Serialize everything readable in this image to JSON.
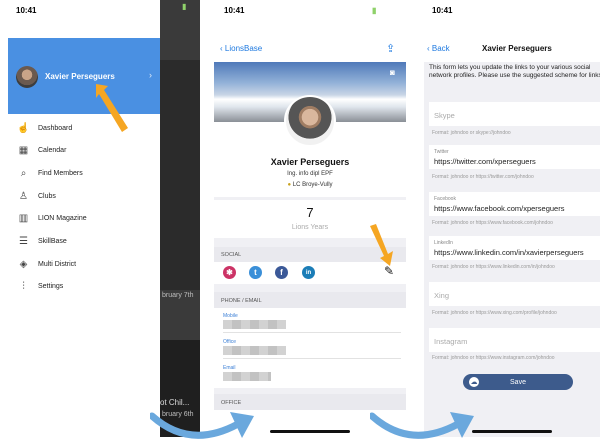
{
  "status_time": "10:41",
  "screen1": {
    "user_name": "Xavier Perseguers",
    "menu": [
      {
        "label": "Dashboard",
        "icon": "hand-pointer-icon"
      },
      {
        "label": "Calendar",
        "icon": "calendar-icon"
      },
      {
        "label": "Find Members",
        "icon": "magnifier-icon"
      },
      {
        "label": "Clubs",
        "icon": "medal-icon"
      },
      {
        "label": "LION Magazine",
        "icon": "magazine-icon"
      },
      {
        "label": "SkillBase",
        "icon": "list-icon"
      },
      {
        "label": "Multi District",
        "icon": "layers-icon"
      },
      {
        "label": "Settings",
        "icon": "sliders-icon"
      }
    ],
    "background_texts": [
      "bruary 7th",
      "ot Chil...",
      "bruary 6th"
    ]
  },
  "screen2": {
    "back_label": "LionsBase",
    "name": "Xavier Perseguers",
    "title": "Ing. info dipl EPF",
    "club": "LC Broye-Vully",
    "years_value": "7",
    "years_label": "Lions Years",
    "social_title": "SOCIAL",
    "phone_title": "PHONE / EMAIL",
    "fields": [
      "Mobile",
      "Office",
      "Email"
    ],
    "office_title": "OFFICE"
  },
  "screen3": {
    "back_label": "Back",
    "title": "Xavier Perseguers",
    "intro": "This form lets you update the links to your various social network profiles. Please use the suggested scheme for links.",
    "fields": [
      {
        "label": "",
        "placeholder": "Skype",
        "value": "",
        "format": "Format: johndoo or skype://johndoo"
      },
      {
        "label": "Twitter",
        "placeholder": "",
        "value": "https://twitter.com/xperseguers",
        "format": "Format: johndoo or https://twitter.com/johndoo"
      },
      {
        "label": "Facebook",
        "placeholder": "",
        "value": "https://www.facebook.com/xperseguers",
        "format": "Format: johndoo or https://www.facebook.com/johndoo"
      },
      {
        "label": "LinkedIn",
        "placeholder": "",
        "value": "https://www.linkedin.com/in/xavierperseguers",
        "format": "Format: johndoo or https://www.linkedin.com/in/johndoo"
      },
      {
        "label": "",
        "placeholder": "Xing",
        "value": "",
        "format": "Format: johndoo or https://www.xing.com/profile/johndoo"
      },
      {
        "label": "",
        "placeholder": "Instagram",
        "value": "",
        "format": "Format: johndoo or https://www.instagram.com/johndoo"
      }
    ],
    "save_label": "Save"
  },
  "colors": {
    "accent_blue": "#4a90e2",
    "orange_arrow": "#f5a623",
    "save_button": "#3d5b8c",
    "flow_arrow": "#6aa8dd"
  }
}
